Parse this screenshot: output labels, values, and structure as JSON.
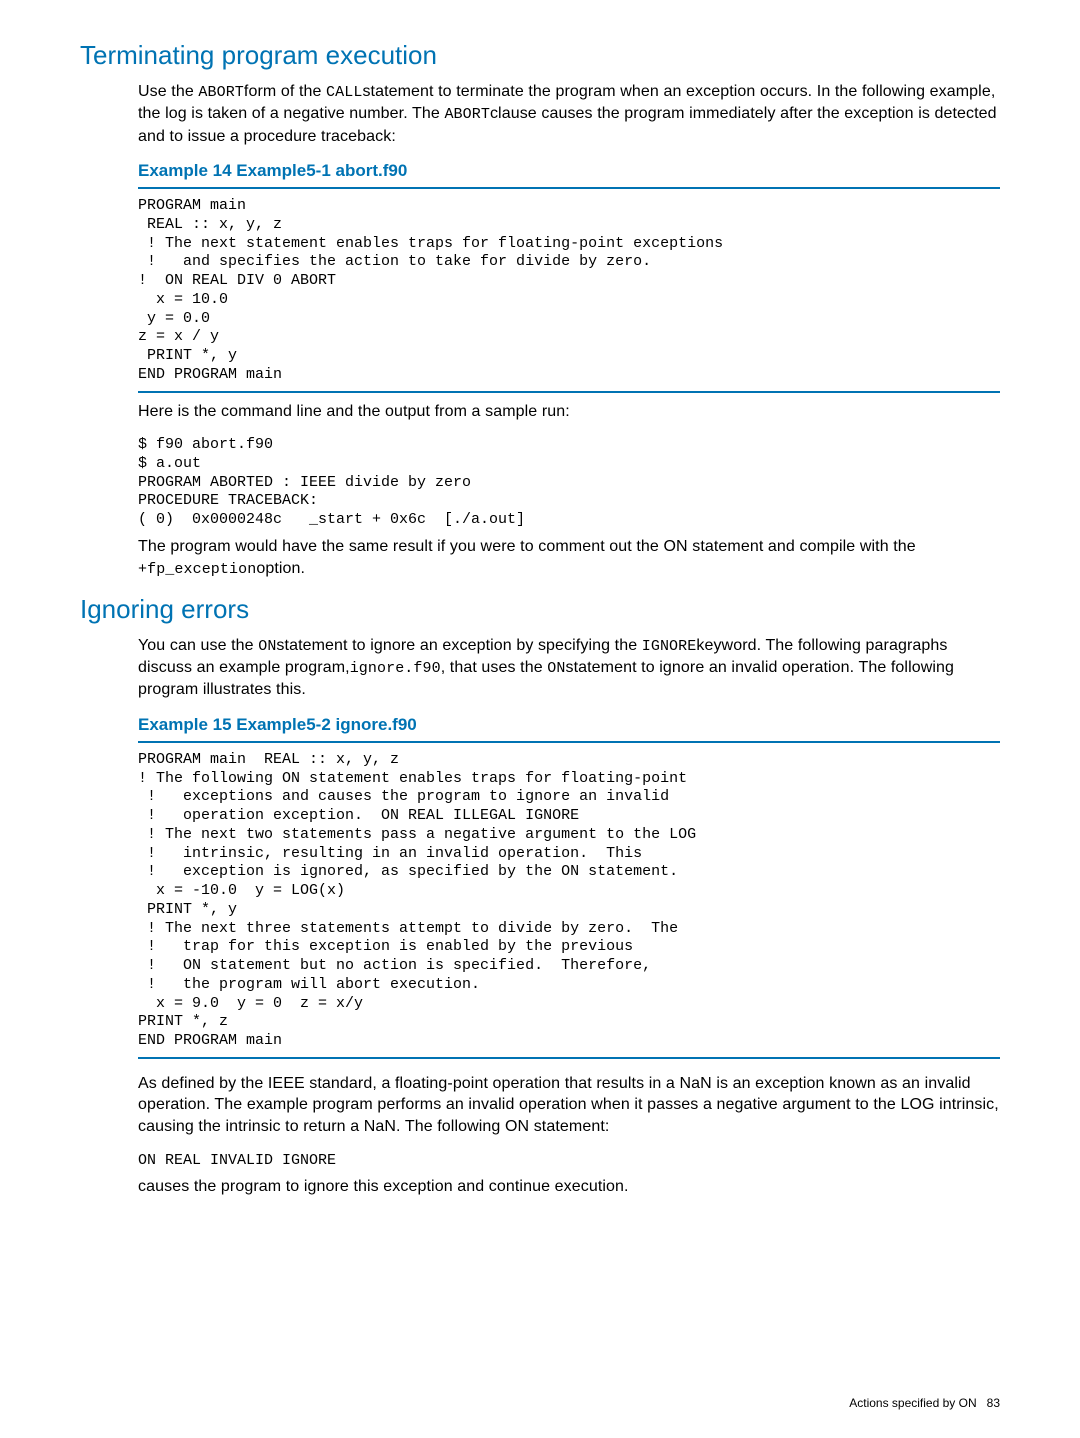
{
  "section1": {
    "title": "Terminating program execution",
    "p1_a": "Use the ",
    "p1_m1": "ABORT",
    "p1_b": "form of the ",
    "p1_m2": "CALL",
    "p1_c": "statement to terminate the program when an exception occurs. In the following example, the log is taken of a negative number. The ",
    "p1_m3": "ABORT",
    "p1_d": "clause causes the program immediately after the exception is detected and to issue a procedure traceback:",
    "example_title": "Example 14 Example5-1 abort.f90",
    "code1": "PROGRAM main\n REAL :: x, y, z\n ! The next statement enables traps for floating-point exceptions\n !   and specifies the action to take for divide by zero.\n!  ON REAL DIV 0 ABORT\n  x = 10.0\n y = 0.0\nz = x / y\n PRINT *, y\nEND PROGRAM main",
    "p2": "Here is the command line and the output from a sample run:",
    "code2": "$ f90 abort.f90\n$ a.out\nPROGRAM ABORTED : IEEE divide by zero\nPROCEDURE TRACEBACK:\n( 0)  0x0000248c   _start + 0x6c  [./a.out]",
    "p3_a": "The program would have the same result if you were to comment out the ON statement and compile with the ",
    "p3_m1": "+fp_exception",
    "p3_b": "option."
  },
  "section2": {
    "title": "Ignoring errors",
    "p1_a": "You can use the ",
    "p1_m1": "ON",
    "p1_b": "statement to ignore an exception by specifying the ",
    "p1_m2": "IGNORE",
    "p1_c": "keyword. The following paragraphs discuss an example program,",
    "p1_m3": "ignore.f90",
    "p1_d": ", that uses the ",
    "p1_m4": "ON",
    "p1_e": "statement to ignore an invalid operation. The following program illustrates this.",
    "example_title": "Example 15 Example5-2 ignore.f90",
    "code1": "PROGRAM main  REAL :: x, y, z\n! The following ON statement enables traps for floating-point\n !   exceptions and causes the program to ignore an invalid\n !   operation exception.  ON REAL ILLEGAL IGNORE\n ! The next two statements pass a negative argument to the LOG\n !   intrinsic, resulting in an invalid operation.  This\n !   exception is ignored, as specified by the ON statement.\n  x = -10.0  y = LOG(x)\n PRINT *, y\n ! The next three statements attempt to divide by zero.  The\n !   trap for this exception is enabled by the previous\n !   ON statement but no action is specified.  Therefore,\n !   the program will abort execution.\n  x = 9.0  y = 0  z = x/y\nPRINT *, z\nEND PROGRAM main",
    "p2": "As defined by the IEEE standard, a floating-point operation that results in a NaN is an exception known as an invalid operation. The example program performs an invalid operation when it passes a negative argument to the LOG intrinsic, causing the intrinsic to return a NaN. The following ON statement:",
    "code2": "ON REAL INVALID IGNORE",
    "p3": "causes the program to ignore this exception and continue execution."
  },
  "footer": {
    "label": "Actions specified by ON",
    "page": "83"
  }
}
